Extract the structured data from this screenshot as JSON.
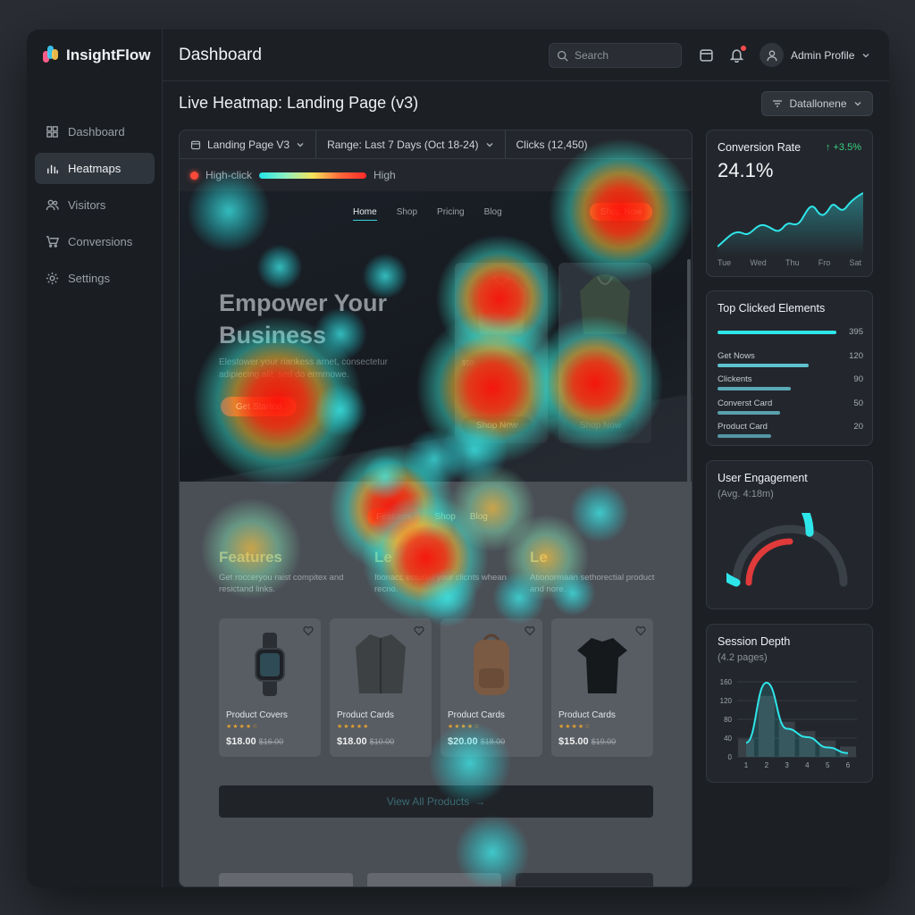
{
  "app": {
    "name": "InsightFlow"
  },
  "sidebar": {
    "items": [
      {
        "label": "Dashboard",
        "icon": "grid-icon"
      },
      {
        "label": "Heatmaps",
        "icon": "bar-chart-icon",
        "active": true
      },
      {
        "label": "Visitors",
        "icon": "users-icon"
      },
      {
        "label": "Conversions",
        "icon": "cart-icon"
      },
      {
        "label": "Settings",
        "icon": "gear-icon"
      }
    ]
  },
  "header": {
    "title": "Dashboard",
    "search_placeholder": "Search",
    "profile": "Admin Profile"
  },
  "main": {
    "title": "Live Heatmap: Landing Page (v3)",
    "filter_label": "Datallonene"
  },
  "toolbar": {
    "page": "Landing Page V3",
    "range": "Range: Last 7 Days (Oct 18-24)",
    "clicks": "Clicks (12,450)"
  },
  "legend": {
    "low": "High-click",
    "high": "High"
  },
  "site": {
    "nav": [
      "Home",
      "Shop",
      "Pricing",
      "Blog"
    ],
    "shop_now": "Shop Now",
    "hero_title": "Empower Your Business",
    "hero_sub": "Elestower your riankess arnet, consectetur adipiecing alit, sed do ermmowe.",
    "get_started": "Get Started",
    "hero_card_button": "Shop Now",
    "hero_card_price": "$50",
    "sub_nav": [
      "Features",
      "Shop",
      "Blog"
    ],
    "features": [
      {
        "title": "Features",
        "text": "Get rocceryou raist compitex and resictand links."
      },
      {
        "title": "Le",
        "text": "Itionacc ectured your clicnts whean recno."
      },
      {
        "title": "Le",
        "text": "Atioriormaan sethorectial product and nore."
      }
    ],
    "products": [
      {
        "name": "Product Covers",
        "stars": "★★★★☆",
        "price": "$18.00",
        "old": "$16.00",
        "icon": "smartwatch-icon"
      },
      {
        "name": "Product Cards",
        "stars": "★★★★★",
        "price": "$18.00",
        "old": "$10.00",
        "icon": "jacket-icon"
      },
      {
        "name": "Product Cards",
        "stars": "★★★★☆",
        "price": "$20.00",
        "old": "$18.00",
        "icon": "backpack-icon"
      },
      {
        "name": "Product Cards",
        "stars": "★★★★☆",
        "price": "$15.00",
        "old": "$19.00",
        "icon": "tshirt-icon"
      }
    ],
    "view_all": "View All Products"
  },
  "widgets": {
    "conversion": {
      "title": "Conversion Rate",
      "delta": "↑ +3.5%",
      "value": "24.1%",
      "days": [
        "Tue",
        "Wed",
        "Thu",
        "Fro",
        "Sat"
      ]
    },
    "top_clicked": {
      "title": "Top Clicked Elements",
      "rows": [
        {
          "label": "",
          "value": "395",
          "fill": 1.0
        },
        {
          "label": "Get Nows",
          "value": "120",
          "fill": 0.77
        },
        {
          "label": "Clickents",
          "value": "90",
          "fill": 0.62
        },
        {
          "label": "Converst Card",
          "value": "50",
          "fill": 0.53
        },
        {
          "label": "Product Card",
          "value": "20",
          "fill": 0.45
        }
      ]
    },
    "engagement": {
      "title": "User Engagement",
      "sub": "(Avg. 4:18m)",
      "level": 0.62,
      "secondary": 0.5
    },
    "session": {
      "title": "Session Depth",
      "sub": "(4.2 pages)"
    }
  },
  "chart_data": {
    "type": "area",
    "x": [
      1,
      2,
      3,
      4,
      5,
      6
    ],
    "xlabel": "",
    "ylabel": "",
    "yticks": [
      0,
      40,
      80,
      120,
      160
    ],
    "ylim": [
      0,
      160
    ],
    "bars": [
      38,
      130,
      75,
      55,
      35,
      22
    ],
    "series": [
      {
        "values": [
          30,
          158,
          60,
          42,
          20,
          8
        ]
      }
    ],
    "grid": true
  },
  "colors": {
    "accent": "#2ee6ea",
    "hot": "#ff2a1a",
    "bg": "#1c1f24"
  }
}
